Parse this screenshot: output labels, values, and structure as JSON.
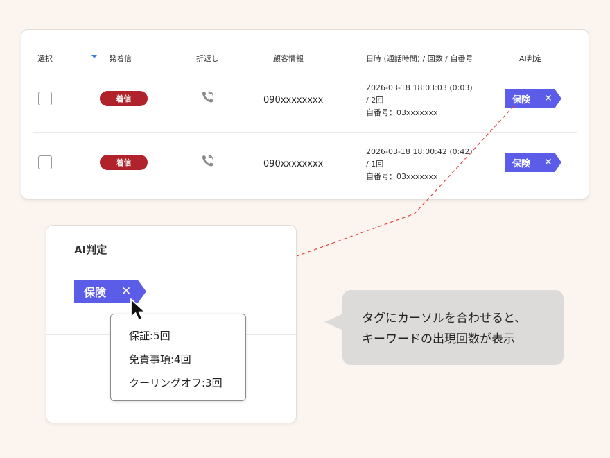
{
  "table": {
    "headers": {
      "select": "選択",
      "direction": "発着信",
      "callback": "折返し",
      "customer": "顧客情報",
      "datetime": "日時 (通話時間) / 回数 / 自番号",
      "ai": "AI判定"
    },
    "rows": [
      {
        "badge": "着信",
        "phone": "090xxxxxxxx",
        "datetime": "2026-03-18 18:03:03 (0:03)",
        "count": "/ 2回",
        "own_number": "自番号：03xxxxxxx",
        "tag": "保険",
        "tag_close": "✕"
      },
      {
        "badge": "着信",
        "phone": "090xxxxxxxx",
        "datetime": "2026-03-18 18:00:42 (0:42)",
        "count": "/ 1回",
        "own_number": "自番号：03xxxxxxx",
        "tag": "保険",
        "tag_close": "✕"
      }
    ]
  },
  "detail_card": {
    "title": "AI判定",
    "tag": "保険",
    "tag_close": "✕",
    "keywords": [
      "保証:5回",
      "免責事項:4回",
      "クーリングオフ:3回"
    ]
  },
  "callout": {
    "line1": "タグにカーソルを合わせると、",
    "line2": "キーワードの出現回数が表示"
  },
  "colors": {
    "tag": "#5b5de8",
    "badge": "#b0232a",
    "connector": "#e0443e",
    "background": "#fcf5ef"
  },
  "icons": {
    "sort": "sort-down-icon",
    "callback": "phone-callback-icon",
    "cursor": "mouse-pointer-icon"
  }
}
